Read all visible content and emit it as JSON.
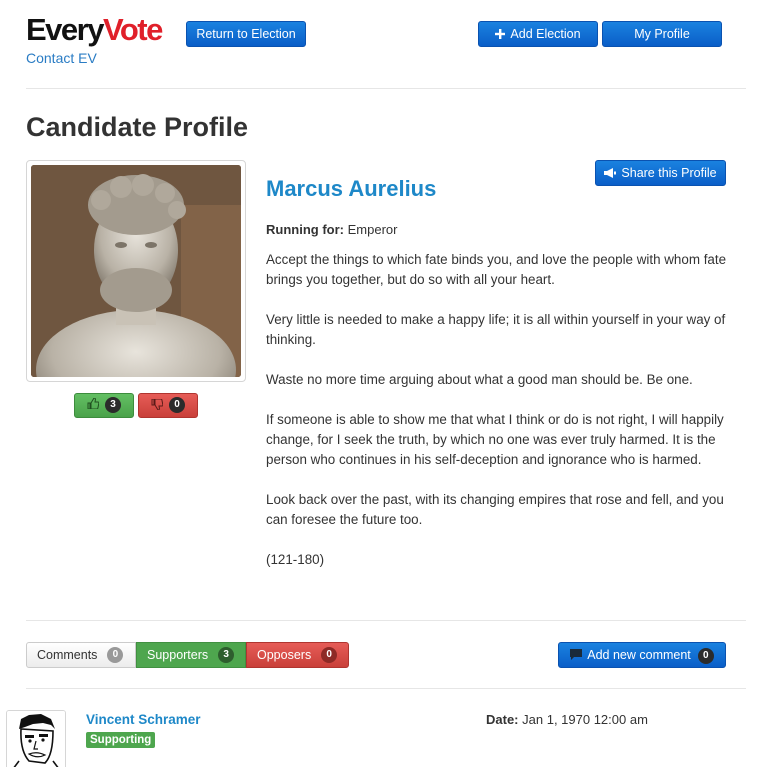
{
  "header": {
    "logo_every": "Every",
    "logo_vote": "Vote",
    "contact_link": "Contact EV",
    "return_button": "Return to Election",
    "add_election_button": "Add Election",
    "my_profile_button": "My Profile"
  },
  "page": {
    "title": "Candidate Profile"
  },
  "candidate": {
    "name": "Marcus Aurelius",
    "running_for_label": "Running for:",
    "running_for_value": "Emperor",
    "share_button": "Share this Profile",
    "likes": "3",
    "dislikes": "0",
    "bio": [
      "Accept the things to which fate binds you, and love the people with whom fate brings you together, but do so with all your heart.",
      "Very little is needed to make a happy life; it is all within yourself in your way of thinking.",
      "Waste no more time arguing about what a good man should be. Be one.",
      "If someone is able to show me that what I think or do is not right, I will happily change, for I seek the truth, by which no one was ever truly harmed. It is the person who continues in his self-deception and ignorance who is harmed.",
      "Look back over the past, with its changing empires that rose and fell, and you can foresee the future too.",
      "(121-180)"
    ]
  },
  "tabs": {
    "comments_label": "Comments",
    "comments_count": "0",
    "supporters_label": "Supporters",
    "supporters_count": "3",
    "opposers_label": "Opposers",
    "opposers_count": "0",
    "add_comment_label": "Add new comment",
    "add_comment_count": "0"
  },
  "comment": {
    "author": "Vincent Schramer",
    "badge": "Supporting",
    "date_label": "Date:",
    "date_value": "Jan 1, 1970 12:00 am"
  },
  "colors": {
    "brand_red": "#e0202a",
    "primary_blue": "#0a5ec8",
    "link_blue": "#1e88c8",
    "success_green": "#4ea64e",
    "danger_red": "#c9403a"
  },
  "icons": {
    "add_election": "plus-icon",
    "share": "megaphone-icon",
    "like": "thumbs-up-icon",
    "dislike": "thumbs-down-icon",
    "add_comment": "comment-icon"
  }
}
